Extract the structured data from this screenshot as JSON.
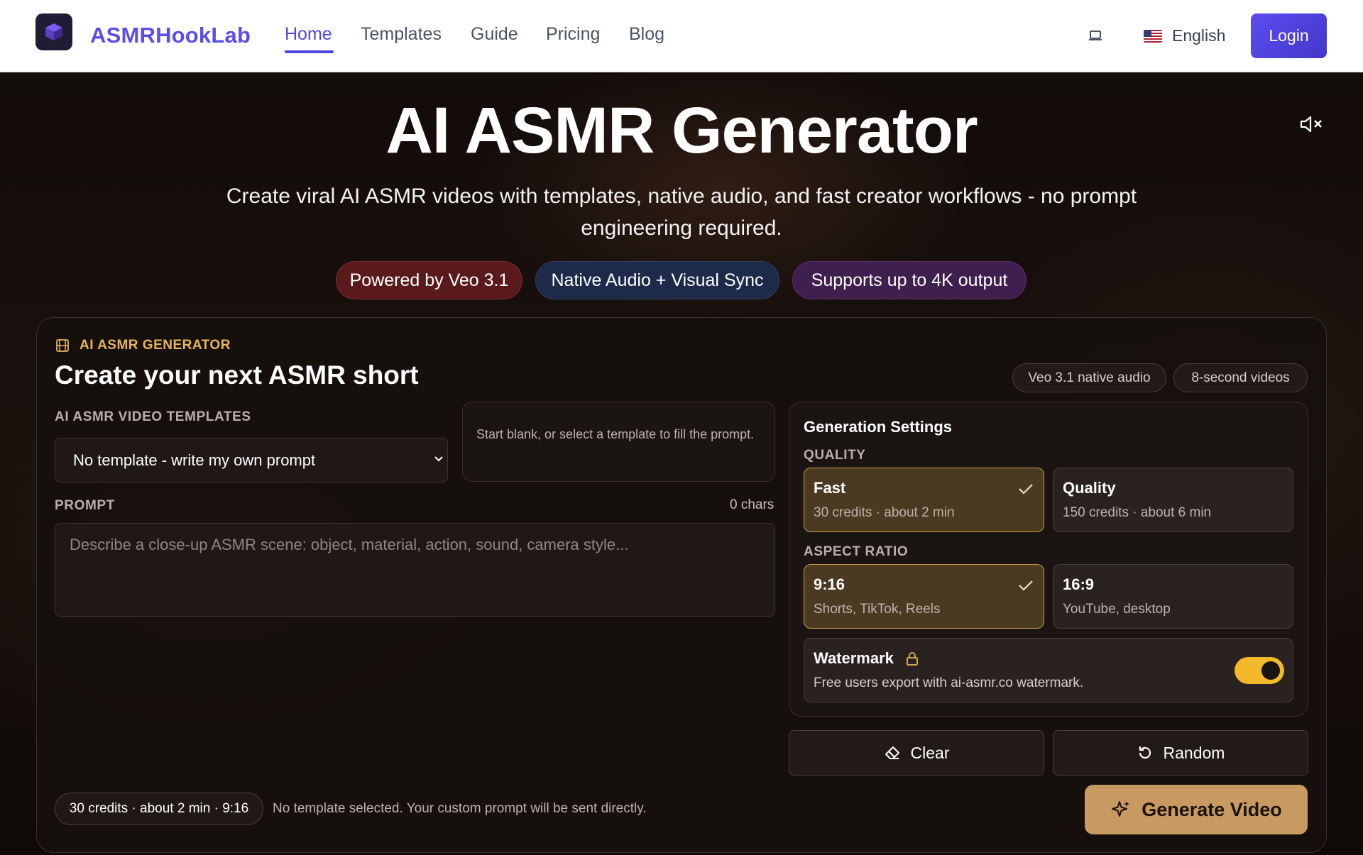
{
  "nav": {
    "brand": "ASMRHookLab",
    "links": [
      "Home",
      "Templates",
      "Guide",
      "Pricing",
      "Blog"
    ],
    "language": "English",
    "login_label": "Login",
    "accent_color": "#4f46e5"
  },
  "hero": {
    "title": "AI ASMR Generator",
    "subtitle": "Create viral AI ASMR videos with templates, native audio, and fast creator workflows - no prompt engineering required.",
    "pills": [
      "Powered by Veo 3.1",
      "Native Audio + Visual Sync",
      "Supports up to 4K output"
    ]
  },
  "card": {
    "kicker": "AI ASMR GENERATOR",
    "title": "Create your next ASMR short",
    "tags": [
      "Veo 3.1 native audio",
      "8-second videos"
    ],
    "templates_label": "AI ASMR VIDEO TEMPLATES",
    "template_selected": "No template - write my own prompt",
    "hint": "Start blank, or select a template to fill the prompt.",
    "prompt_label": "PROMPT",
    "chars": "0 chars",
    "prompt_placeholder": "Describe a close-up ASMR scene: object, material, action, sound, camera style..."
  },
  "settings": {
    "title": "Generation Settings",
    "quality_label": "QUALITY",
    "quality_options": [
      {
        "title": "Fast",
        "sub": "30 credits · about 2 min",
        "selected": true
      },
      {
        "title": "Quality",
        "sub": "150 credits · about 6 min",
        "selected": false
      }
    ],
    "aspect_label": "ASPECT RATIO",
    "aspect_options": [
      {
        "title": "9:16",
        "sub": "Shorts, TikTok, Reels",
        "selected": true
      },
      {
        "title": "16:9",
        "sub": "YouTube, desktop",
        "selected": false
      }
    ],
    "watermark_title": "Watermark",
    "watermark_sub": "Free users export with ai-asmr.co watermark.",
    "watermark_on": true
  },
  "actions": {
    "clear": "Clear",
    "random": "Random",
    "generate": "Generate Video"
  },
  "status": {
    "summary": "30 credits · about 2 min · 9:16",
    "message": "No template selected. Your custom prompt will be sent directly."
  }
}
